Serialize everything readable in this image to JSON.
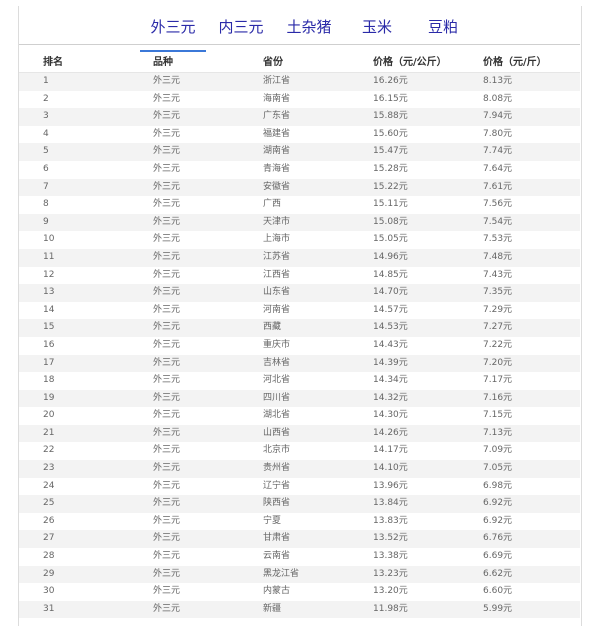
{
  "tabs": [
    {
      "label": "外三元"
    },
    {
      "label": "内三元"
    },
    {
      "label": "土杂猪"
    },
    {
      "label": "玉米"
    },
    {
      "label": "豆粕"
    }
  ],
  "table": {
    "headers": [
      "排名",
      "品种",
      "省份",
      "价格（元/公斤）",
      "价格（元/斤）"
    ],
    "rows": [
      [
        "1",
        "外三元",
        "浙江省",
        "16.26元",
        "8.13元"
      ],
      [
        "2",
        "外三元",
        "海南省",
        "16.15元",
        "8.08元"
      ],
      [
        "3",
        "外三元",
        "广东省",
        "15.88元",
        "7.94元"
      ],
      [
        "4",
        "外三元",
        "福建省",
        "15.60元",
        "7.80元"
      ],
      [
        "5",
        "外三元",
        "湖南省",
        "15.47元",
        "7.74元"
      ],
      [
        "6",
        "外三元",
        "青海省",
        "15.28元",
        "7.64元"
      ],
      [
        "7",
        "外三元",
        "安徽省",
        "15.22元",
        "7.61元"
      ],
      [
        "8",
        "外三元",
        "广西",
        "15.11元",
        "7.56元"
      ],
      [
        "9",
        "外三元",
        "天津市",
        "15.08元",
        "7.54元"
      ],
      [
        "10",
        "外三元",
        "上海市",
        "15.05元",
        "7.53元"
      ],
      [
        "11",
        "外三元",
        "江苏省",
        "14.96元",
        "7.48元"
      ],
      [
        "12",
        "外三元",
        "江西省",
        "14.85元",
        "7.43元"
      ],
      [
        "13",
        "外三元",
        "山东省",
        "14.70元",
        "7.35元"
      ],
      [
        "14",
        "外三元",
        "河南省",
        "14.57元",
        "7.29元"
      ],
      [
        "15",
        "外三元",
        "西藏",
        "14.53元",
        "7.27元"
      ],
      [
        "16",
        "外三元",
        "重庆市",
        "14.43元",
        "7.22元"
      ],
      [
        "17",
        "外三元",
        "吉林省",
        "14.39元",
        "7.20元"
      ],
      [
        "18",
        "外三元",
        "河北省",
        "14.34元",
        "7.17元"
      ],
      [
        "19",
        "外三元",
        "四川省",
        "14.32元",
        "7.16元"
      ],
      [
        "20",
        "外三元",
        "湖北省",
        "14.30元",
        "7.15元"
      ],
      [
        "21",
        "外三元",
        "山西省",
        "14.26元",
        "7.13元"
      ],
      [
        "22",
        "外三元",
        "北京市",
        "14.17元",
        "7.09元"
      ],
      [
        "23",
        "外三元",
        "贵州省",
        "14.10元",
        "7.05元"
      ],
      [
        "24",
        "外三元",
        "辽宁省",
        "13.96元",
        "6.98元"
      ],
      [
        "25",
        "外三元",
        "陕西省",
        "13.84元",
        "6.92元"
      ],
      [
        "26",
        "外三元",
        "宁夏",
        "13.83元",
        "6.92元"
      ],
      [
        "27",
        "外三元",
        "甘肃省",
        "13.52元",
        "6.76元"
      ],
      [
        "28",
        "外三元",
        "云南省",
        "13.38元",
        "6.69元"
      ],
      [
        "29",
        "外三元",
        "黑龙江省",
        "13.23元",
        "6.62元"
      ],
      [
        "30",
        "外三元",
        "内蒙古",
        "13.20元",
        "6.60元"
      ],
      [
        "31",
        "外三元",
        "新疆",
        "11.98元",
        "5.99元"
      ]
    ]
  },
  "colors": {
    "tab_text": "#2a2aa8",
    "tab_active_underline": "#3b78d8",
    "row_stripe": "#f3f3f3"
  }
}
